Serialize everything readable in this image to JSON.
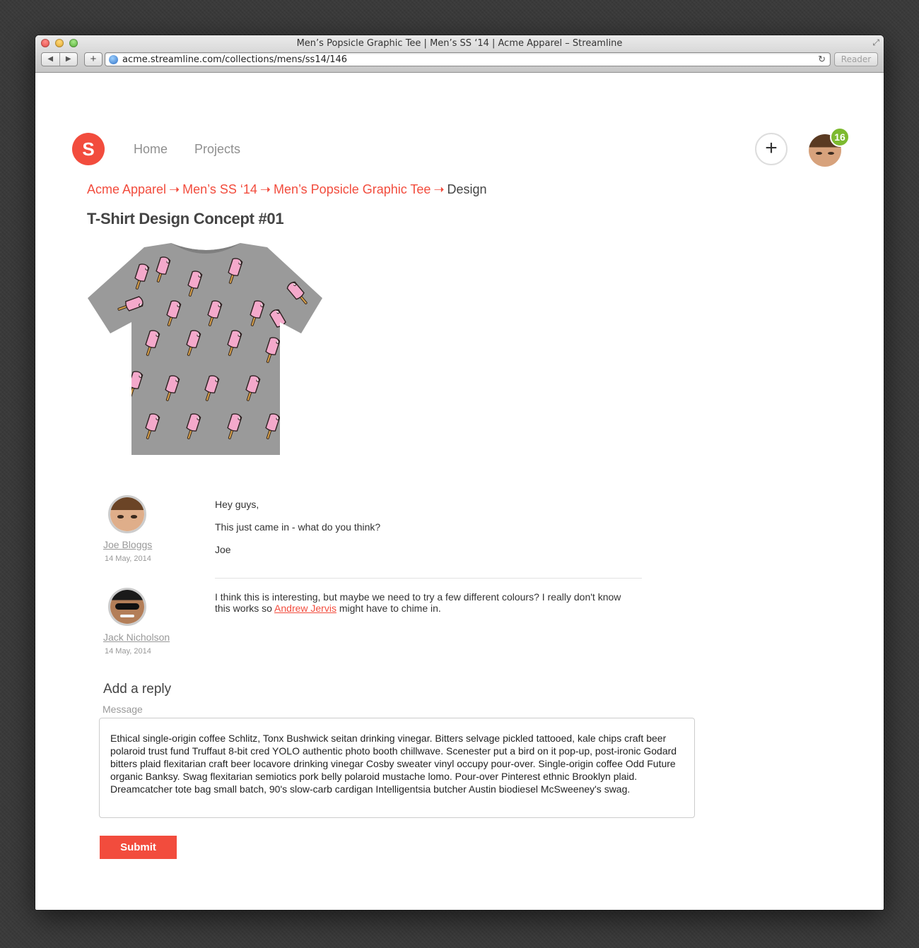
{
  "browser": {
    "window_title": "Men’s Popsicle Graphic Tee | Men’s SS ‘14 | Acme Apparel – Streamline",
    "url": "acme.streamline.com/collections/mens/ss14/146",
    "reader_label": "Reader",
    "back_glyph": "◀",
    "forward_glyph": "▶",
    "add_glyph": "+",
    "reload_glyph": "↻"
  },
  "app": {
    "logo_letter": "S",
    "nav": [
      "Home",
      "Projects"
    ],
    "new_glyph": "+",
    "notification_count": "16",
    "accent_color": "#f24c3d",
    "badge_color": "#7dba2f"
  },
  "breadcrumb": {
    "items": [
      "Acme Apparel",
      "Men’s SS ‘14",
      "Men’s Popsicle Graphic Tee"
    ],
    "separator": "➝",
    "current": "Design"
  },
  "page_title": "T-Shirt Design Concept #01",
  "comments": [
    {
      "author": "Joe Bloggs",
      "date": "14 May, 2014",
      "paragraphs": [
        "Hey guys,",
        "This just came in - what do you think?",
        "Joe"
      ]
    },
    {
      "author": "Jack Nicholson",
      "date": "14 May, 2014",
      "text_before": "I think this is interesting, but maybe we need to try a few different colours? I really don't know this works so ",
      "mention": "Andrew Jervis",
      "text_after": " might have to chime in."
    }
  ],
  "reply": {
    "title": "Add a reply",
    "label": "Message",
    "value": "Ethical single-origin coffee Schlitz, Tonx Bushwick seitan drinking vinegar. Bitters selvage pickled tattooed, kale chips craft beer polaroid trust fund Truffaut 8-bit cred YOLO authentic photo booth chillwave. Scenester put a bird on it pop-up, post-ironic Godard bitters plaid flexitarian craft beer locavore drinking vinegar Cosby sweater vinyl occupy pour-over. Single-origin coffee Odd Future organic Banksy. Swag flexitarian semiotics pork belly polaroid mustache lomo. Pour-over Pinterest ethnic Brooklyn plaid. Dreamcatcher tote bag small batch, 90's slow-carb cardigan Intelligentsia butcher Austin biodiesel McSweeney's swag.",
    "submit_label": "Submit"
  }
}
